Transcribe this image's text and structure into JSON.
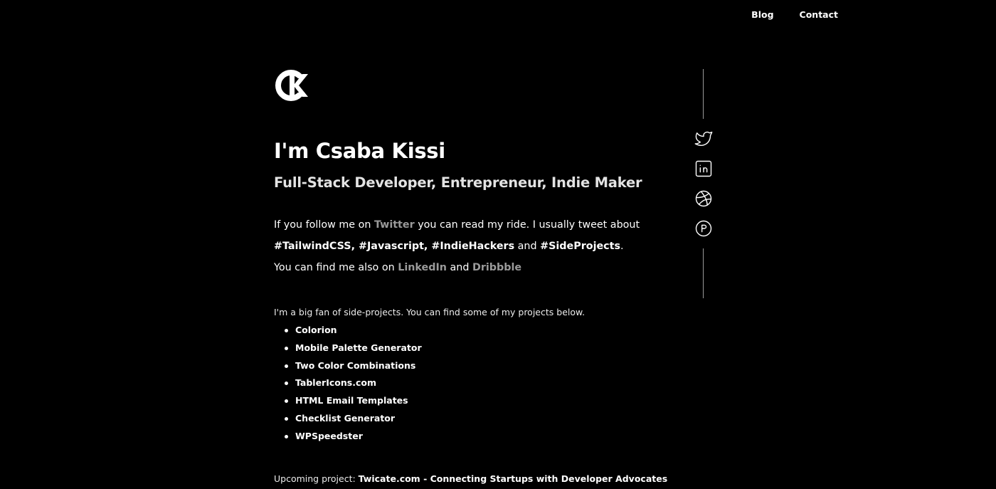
{
  "nav": {
    "blog_label": "Blog",
    "contact_label": "Contact"
  },
  "header": {
    "title": "I'm Csaba Kissi",
    "subtitle": "Full-Stack Developer, Entrepreneur, Indie Maker"
  },
  "intro": {
    "line1_prefix": "If you follow me on ",
    "twitter_link": "Twitter",
    "line1_suffix": " you can read my ride. I usually tweet about",
    "tag1": "#TailwindCSS",
    "sep1": ", ",
    "tag2": "#Javascript",
    "sep2": ", ",
    "tag3": "#IndieHackers",
    "and1": " and ",
    "tag4": "#SideProjects",
    "period": ".",
    "line3_prefix": "You can find me also on ",
    "linkedin_link": "LinkedIn",
    "and2": " and ",
    "dribbble_link": "Dribbble"
  },
  "projects": {
    "intro": "I'm a big fan of side-projects. You can find some of my projects below.",
    "items": [
      "Colorion",
      "Mobile Palette Generator",
      "Two Color Combinations",
      "TablerIcons.com",
      "HTML Email Templates",
      "Checklist Generator",
      "WPSpeedster"
    ]
  },
  "upcoming": {
    "label": "Upcoming project: ",
    "project": "Twicate.com - Connecting Startups with Developer Advocates"
  },
  "social": {
    "icons": [
      "twitter-icon",
      "linkedin-icon",
      "dribbble-icon",
      "producthunt-icon"
    ]
  },
  "colors": {
    "background": "#000000",
    "text": "#ffffff",
    "link_muted": "#9a9a9a"
  }
}
